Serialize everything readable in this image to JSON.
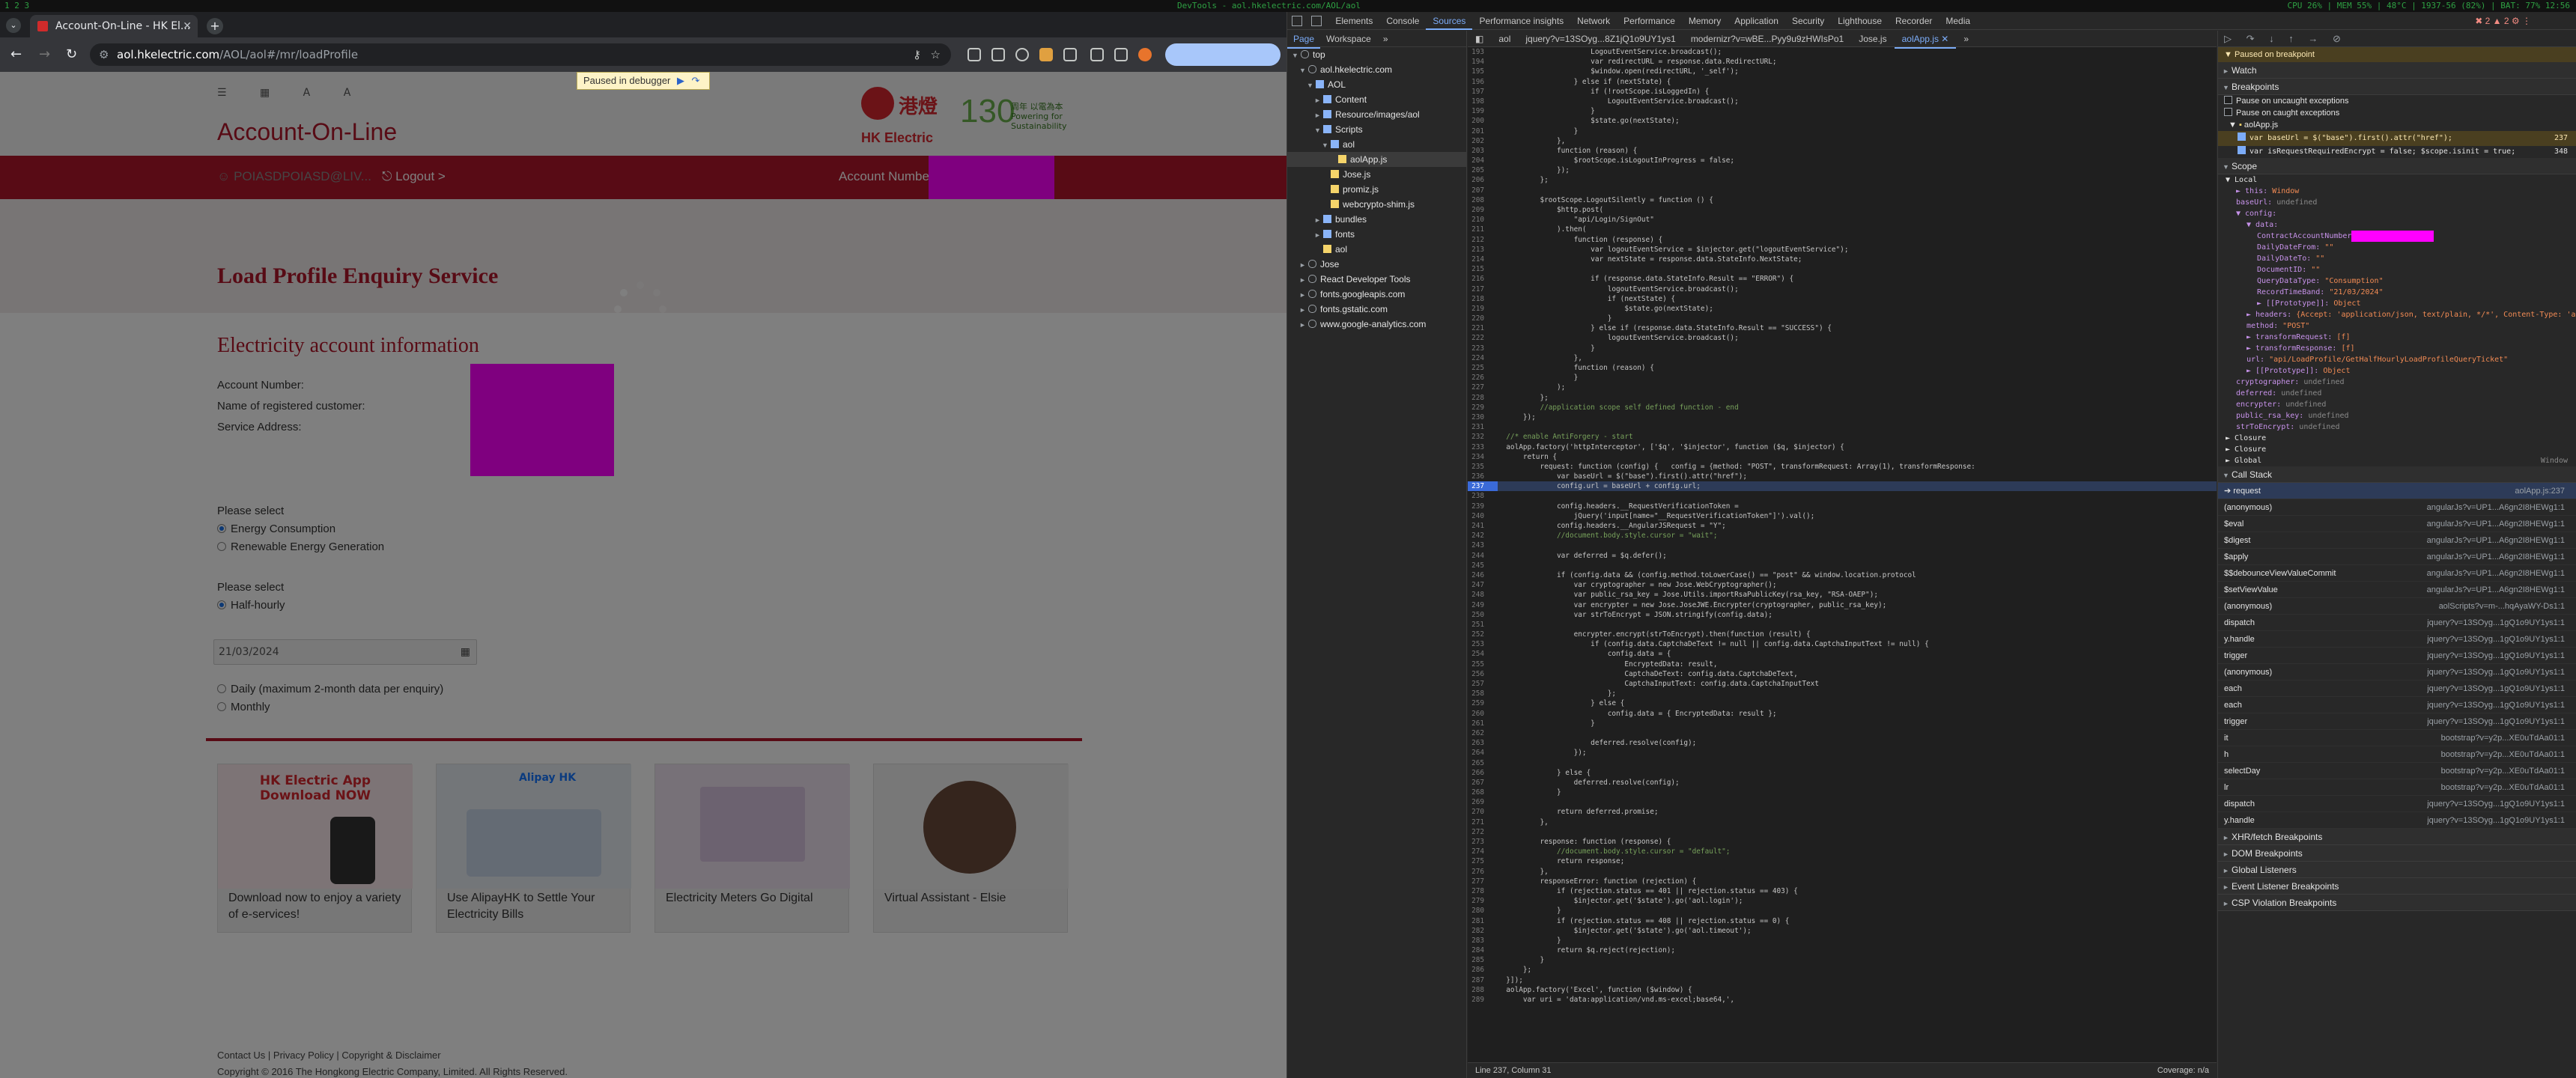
{
  "topbar": {
    "left": "1  2  3",
    "center": "DevTools - aol.hkelectric.com/AOL/aol",
    "right": "CPU 26% | MEM 55% | 48°C | 1937-56 (82%) | BAT: 77% 12:56"
  },
  "browser": {
    "tab_title": "Account-On-Line - HK El...",
    "url_site": "aol.hkelectric.com",
    "url_path": "/AOL/aol#/mr/loadProfile",
    "paused_label": "Paused in debugger"
  },
  "page": {
    "header_title": "Account-On-Line",
    "logo_cn": "港燈",
    "logo_en": "HK Electric",
    "logo_130": "130",
    "logo_130_text": "周年 以電為本 Powering for Sustainability",
    "user": "POIASDPOIASD@LIV...",
    "logout": "Logout >",
    "account_number_label": "Account Number:",
    "hero_title": "Load Profile Enquiry Service",
    "section_title": "Electricity account information",
    "account_number": "Account Number:",
    "customer_name": "Name of registered customer:",
    "service_address": "Service Address:",
    "please_select_1": "Please select",
    "opt_energy": "Energy Consumption",
    "opt_renew": "Renewable Energy Generation",
    "please_select_2": "Please select",
    "opt_half": "Half-hourly",
    "date_value": "21/03/2024",
    "opt_daily": "Daily (maximum 2-month data per enquiry)",
    "opt_monthly": "Monthly",
    "cards": [
      {
        "caption": "Download now to enjoy a variety of e-services!",
        "img_text": "HK Electric App Download NOW"
      },
      {
        "caption": "Use AlipayHK to Settle Your Electricity Bills",
        "img_text": "Alipay HK"
      },
      {
        "caption": "Electricity Meters Go Digital",
        "img_text": ""
      },
      {
        "caption": "Virtual Assistant - Elsie",
        "img_text": ""
      }
    ],
    "footer_links": "Contact Us | Privacy Policy | Copyright & Disclaimer",
    "footer_copy": "Copyright © 2016 The Hongkong Electric Company, Limited. All Rights Reserved."
  },
  "devtools": {
    "tabs": [
      "Elements",
      "Console",
      "Sources",
      "Performance insights",
      "Network",
      "Performance",
      "Memory",
      "Application",
      "Security",
      "Lighthouse",
      "Recorder",
      "Media"
    ],
    "active_tab": "Sources",
    "errors": "2",
    "warnings": "2",
    "nav_tabs": [
      "Page",
      "Workspace"
    ],
    "tree": [
      {
        "label": "top",
        "indent": 0,
        "arrow": "▼",
        "icon": "frame"
      },
      {
        "label": "aol.hkelectric.com",
        "indent": 1,
        "arrow": "▼",
        "icon": "cloud"
      },
      {
        "label": "AOL",
        "indent": 2,
        "arrow": "▼",
        "icon": "folder"
      },
      {
        "label": "Content",
        "indent": 3,
        "arrow": "►",
        "icon": "folder"
      },
      {
        "label": "Resource/images/aol",
        "indent": 3,
        "arrow": "►",
        "icon": "folder"
      },
      {
        "label": "Scripts",
        "indent": 3,
        "arrow": "▼",
        "icon": "folder"
      },
      {
        "label": "aol",
        "indent": 4,
        "arrow": "▼",
        "icon": "folder"
      },
      {
        "label": "aolApp.js",
        "indent": 5,
        "arrow": "",
        "icon": "file",
        "selected": true
      },
      {
        "label": "Jose.js",
        "indent": 4,
        "arrow": "",
        "icon": "file"
      },
      {
        "label": "promiz.js",
        "indent": 4,
        "arrow": "",
        "icon": "file"
      },
      {
        "label": "webcrypto-shim.js",
        "indent": 4,
        "arrow": "",
        "icon": "file"
      },
      {
        "label": "bundles",
        "indent": 3,
        "arrow": "►",
        "icon": "folder"
      },
      {
        "label": "fonts",
        "indent": 3,
        "arrow": "►",
        "icon": "folder"
      },
      {
        "label": "aol",
        "indent": 3,
        "arrow": "",
        "icon": "file"
      },
      {
        "label": "Jose",
        "indent": 1,
        "arrow": "►",
        "icon": "cloud"
      },
      {
        "label": "React Developer Tools",
        "indent": 1,
        "arrow": "►",
        "icon": "cloud"
      },
      {
        "label": "fonts.googleapis.com",
        "indent": 1,
        "arrow": "►",
        "icon": "cloud"
      },
      {
        "label": "fonts.gstatic.com",
        "indent": 1,
        "arrow": "►",
        "icon": "cloud"
      },
      {
        "label": "www.google-analytics.com",
        "indent": 1,
        "arrow": "►",
        "icon": "cloud"
      }
    ],
    "editor_tabs": [
      "aol",
      "jquery?v=13SOyg...8Z1jQ1o9UY1ys1",
      "modernizr?v=wBE...Pyy9u9zHWIsPo1",
      "Jose.js",
      "aolApp.js"
    ],
    "active_editor_tab": "aolApp.js",
    "code_start": 193,
    "highlight_line": 237,
    "code": [
      "                      LogoutEventService.broadcast();",
      "                      var redirectURL = response.data.RedirectURL;",
      "                      $window.open(redirectURL, '_self');",
      "                  } else if (nextState) {",
      "                      if (!rootScope.isLoggedIn) {",
      "                          LogoutEventService.broadcast();",
      "                      }",
      "                      $state.go(nextState);",
      "                  }",
      "              },",
      "              function (reason) {",
      "                  $rootScope.isLogoutInProgress = false;",
      "              });",
      "          };",
      "",
      "          $rootScope.LogoutSilently = function () {",
      "              $http.post(",
      "                  \"api/Login/SignOut\"",
      "              ).then(",
      "                  function (response) {",
      "                      var logoutEventService = $injector.get(\"logoutEventService\");",
      "                      var nextState = response.data.StateInfo.NextState;",
      "",
      "                      if (response.data.StateInfo.Result == \"ERROR\") {",
      "                          logoutEventService.broadcast();",
      "                          if (nextState) {",
      "                              $state.go(nextState);",
      "                          }",
      "                      } else if (response.data.StateInfo.Result == \"SUCCESS\") {",
      "                          logoutEventService.broadcast();",
      "                      }",
      "                  },",
      "                  function (reason) {",
      "                  }",
      "              );",
      "          };",
      "          //application scope self defined function - end",
      "      });",
      "",
      "  //* enable AntiForgery - start",
      "  aolApp.factory('httpInterceptor', ['$q', '$injector', function ($q, $injector) {",
      "      return {",
      "          request: function (config) {   config = {method: \"POST\", transformRequest: Array(1), transformResponse:",
      "              var baseUrl = $(\"base\").first().attr(\"href\");",
      "              config.url = baseUrl + config.url;",
      "",
      "              config.headers.__RequestVerificationToken =",
      "                  jQuery('input[name=\"__RequestVerificationToken\"]').val();",
      "              config.headers.__AngularJSRequest = \"Y\";",
      "              //document.body.style.cursor = \"wait\";",
      "",
      "              var deferred = $q.defer();",
      "",
      "              if (config.data && (config.method.toLowerCase() == \"post\" && window.location.protocol",
      "                  var cryptographer = new Jose.WebCryptographer();",
      "                  var public_rsa_key = Jose.Utils.importRsaPublicKey(rsa_key, \"RSA-OAEP\");",
      "                  var encrypter = new Jose.JoseJWE.Encrypter(cryptographer, public_rsa_key);",
      "                  var strToEncrypt = JSON.stringify(config.data);",
      "",
      "                  encrypter.encrypt(strToEncrypt).then(function (result) {",
      "                      if (config.data.CaptchaDeText != null || config.data.CaptchaInputText != null) {",
      "                          config.data = {",
      "                              EncryptedData: result,",
      "                              CaptchaDeText: config.data.CaptchaDeText,",
      "                              CaptchaInputText: config.data.CaptchaInputText",
      "                          };",
      "                      } else {",
      "                          config.data = { EncryptedData: result };",
      "                      }",
      "",
      "                      deferred.resolve(config);",
      "                  });",
      "",
      "              } else {",
      "                  deferred.resolve(config);",
      "              }",
      "",
      "              return deferred.promise;",
      "          },",
      "",
      "          response: function (response) {",
      "              //document.body.style.cursor = \"default\";",
      "              return response;",
      "          },",
      "          responseError: function (rejection) {",
      "              if (rejection.status == 401 || rejection.status == 403) {",
      "                  $injector.get('$state').go('aol.login');",
      "              }",
      "              if (rejection.status == 408 || rejection.status == 0) {",
      "                  $injector.get('$state').go('aol.timeout');",
      "              }",
      "              return $q.reject(rejection);",
      "          }",
      "      };",
      "  }]);",
      "  aolApp.factory('Excel', function ($window) {",
      "      var uri = 'data:application/vnd.ms-excel;base64,',"
    ],
    "status_left": "Line 237, Column 31",
    "status_right": "Coverage: n/a",
    "paused_banner": "Paused on breakpoint",
    "watch": "Watch",
    "breakpoints_header": "Breakpoints",
    "pause_uncaught": "Pause on uncaught exceptions",
    "pause_caught": "Pause on caught exceptions",
    "bp_file": "aolApp.js",
    "bp_items": [
      {
        "code": "var baseUrl = $(\"base\").first().attr(\"href\");",
        "line": "237",
        "active": true
      },
      {
        "code": "var isRequestRequiredEncrypt = false; $scope.isinit = true;",
        "line": "348",
        "active": false
      }
    ],
    "scope_header": "Scope",
    "scope": [
      {
        "t": "▼ Local",
        "d": 0
      },
      {
        "t": "► this: Window",
        "d": 1
      },
      {
        "t": "baseUrl: undefined",
        "d": 1
      },
      {
        "t": "▼ config:",
        "d": 1
      },
      {
        "t": "▼ data:",
        "d": 2
      },
      {
        "t": "ContractAccountNumber:",
        "d": 3
      },
      {
        "t": "DailyDateFrom: \"\"",
        "d": 3
      },
      {
        "t": "DailyDateTo: \"\"",
        "d": 3
      },
      {
        "t": "DocumentID: \"\"",
        "d": 3
      },
      {
        "t": "QueryDataType: \"Consumption\"",
        "d": 3
      },
      {
        "t": "RecordTimeBand: \"21/03/2024\"",
        "d": 3
      },
      {
        "t": "► [[Prototype]]: Object",
        "d": 3
      },
      {
        "t": "► headers: {Accept: 'application/json, text/plain, */*', Content-Type: 'application/json;charset",
        "d": 2
      },
      {
        "t": "method: \"POST\"",
        "d": 2
      },
      {
        "t": "► transformRequest: [f]",
        "d": 2
      },
      {
        "t": "► transformResponse: [f]",
        "d": 2
      },
      {
        "t": "url: \"api/LoadProfile/GetHalfHourlyLoadProfileQueryTicket\"",
        "d": 2
      },
      {
        "t": "► [[Prototype]]: Object",
        "d": 2
      },
      {
        "t": "cryptographer: undefined",
        "d": 1
      },
      {
        "t": "deferred: undefined",
        "d": 1
      },
      {
        "t": "encrypter: undefined",
        "d": 1
      },
      {
        "t": "public_rsa_key: undefined",
        "d": 1
      },
      {
        "t": "strToEncrypt: undefined",
        "d": 1
      },
      {
        "t": "► Closure",
        "d": 0
      },
      {
        "t": "► Closure",
        "d": 0
      },
      {
        "t": "► Global",
        "d": 0
      }
    ],
    "global_right": "Window",
    "callstack_header": "Call Stack",
    "callstack": [
      {
        "fn": "request",
        "loc": "aolApp.js:237"
      },
      {
        "fn": "(anonymous)",
        "loc": "angularJs?v=UP1...A6gn2I8HEWg1:1"
      },
      {
        "fn": "$eval",
        "loc": "angularJs?v=UP1...A6gn2I8HEWg1:1"
      },
      {
        "fn": "$digest",
        "loc": "angularJs?v=UP1...A6gn2I8HEWg1:1"
      },
      {
        "fn": "$apply",
        "loc": "angularJs?v=UP1...A6gn2I8HEWg1:1"
      },
      {
        "fn": "$$debounceViewValueCommit",
        "loc": "angularJs?v=UP1...A6gn2I8HEWg1:1"
      },
      {
        "fn": "$setViewValue",
        "loc": "angularJs?v=UP1...A6gn2I8HEWg1:1"
      },
      {
        "fn": "(anonymous)",
        "loc": "aolScripts?v=m-...hqAyaWY-Ds1:1"
      },
      {
        "fn": "dispatch",
        "loc": "jquery?v=13SOyg...1gQ1o9UY1ys1:1"
      },
      {
        "fn": "y.handle",
        "loc": "jquery?v=13SOyg...1gQ1o9UY1ys1:1"
      },
      {
        "fn": "trigger",
        "loc": "jquery?v=13SOyg...1gQ1o9UY1ys1:1"
      },
      {
        "fn": "(anonymous)",
        "loc": "jquery?v=13SOyg...1gQ1o9UY1ys1:1"
      },
      {
        "fn": "each",
        "loc": "jquery?v=13SOyg...1gQ1o9UY1ys1:1"
      },
      {
        "fn": "each",
        "loc": "jquery?v=13SOyg...1gQ1o9UY1ys1:1"
      },
      {
        "fn": "trigger",
        "loc": "jquery?v=13SOyg...1gQ1o9UY1ys1:1"
      },
      {
        "fn": "it",
        "loc": "bootstrap?v=y2p...XE0uTdAa01:1"
      },
      {
        "fn": "h",
        "loc": "bootstrap?v=y2p...XE0uTdAa01:1"
      },
      {
        "fn": "selectDay",
        "loc": "bootstrap?v=y2p...XE0uTdAa01:1"
      },
      {
        "fn": "lr",
        "loc": "bootstrap?v=y2p...XE0uTdAa01:1"
      },
      {
        "fn": "dispatch",
        "loc": "jquery?v=13SOyg...1gQ1o9UY1ys1:1"
      },
      {
        "fn": "y.handle",
        "loc": "jquery?v=13SOyg...1gQ1o9UY1ys1:1"
      }
    ],
    "bottom_sections": [
      "XHR/fetch Breakpoints",
      "DOM Breakpoints",
      "Global Listeners",
      "Event Listener Breakpoints",
      "CSP Violation Breakpoints"
    ]
  }
}
